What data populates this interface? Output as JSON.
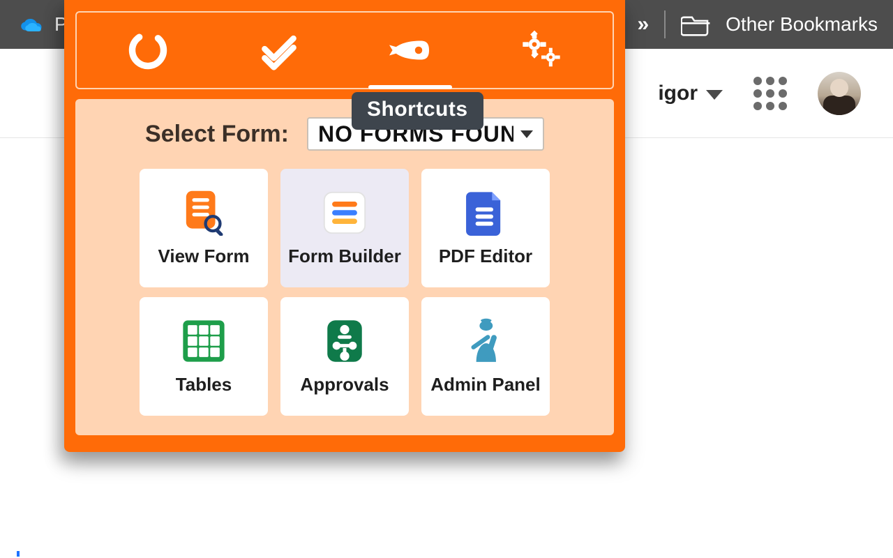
{
  "browser": {
    "bookmark_left_text": "P",
    "overflow_glyph": "»",
    "other_bookmarks_label": "Other Bookmarks"
  },
  "app_header": {
    "username": "igor"
  },
  "popup": {
    "tabs": [
      {
        "name": "status"
      },
      {
        "name": "tasks"
      },
      {
        "name": "shortcuts",
        "active": true
      },
      {
        "name": "settings"
      }
    ],
    "active_tooltip": "Shortcuts",
    "select_label": "Select Form:",
    "select_value": "NO FORMS FOUN",
    "cards": [
      {
        "id": "view-form",
        "label": "View Form"
      },
      {
        "id": "form-builder",
        "label": "Form Builder",
        "hover": true
      },
      {
        "id": "pdf-editor",
        "label": "PDF Editor"
      },
      {
        "id": "tables",
        "label": "Tables"
      },
      {
        "id": "approvals",
        "label": "Approvals"
      },
      {
        "id": "admin-panel",
        "label": "Admin Panel"
      }
    ]
  },
  "colors": {
    "accent": "#ff6b08",
    "accent_light": "#ffd4b3",
    "tooltip_bg": "#3e454d"
  }
}
